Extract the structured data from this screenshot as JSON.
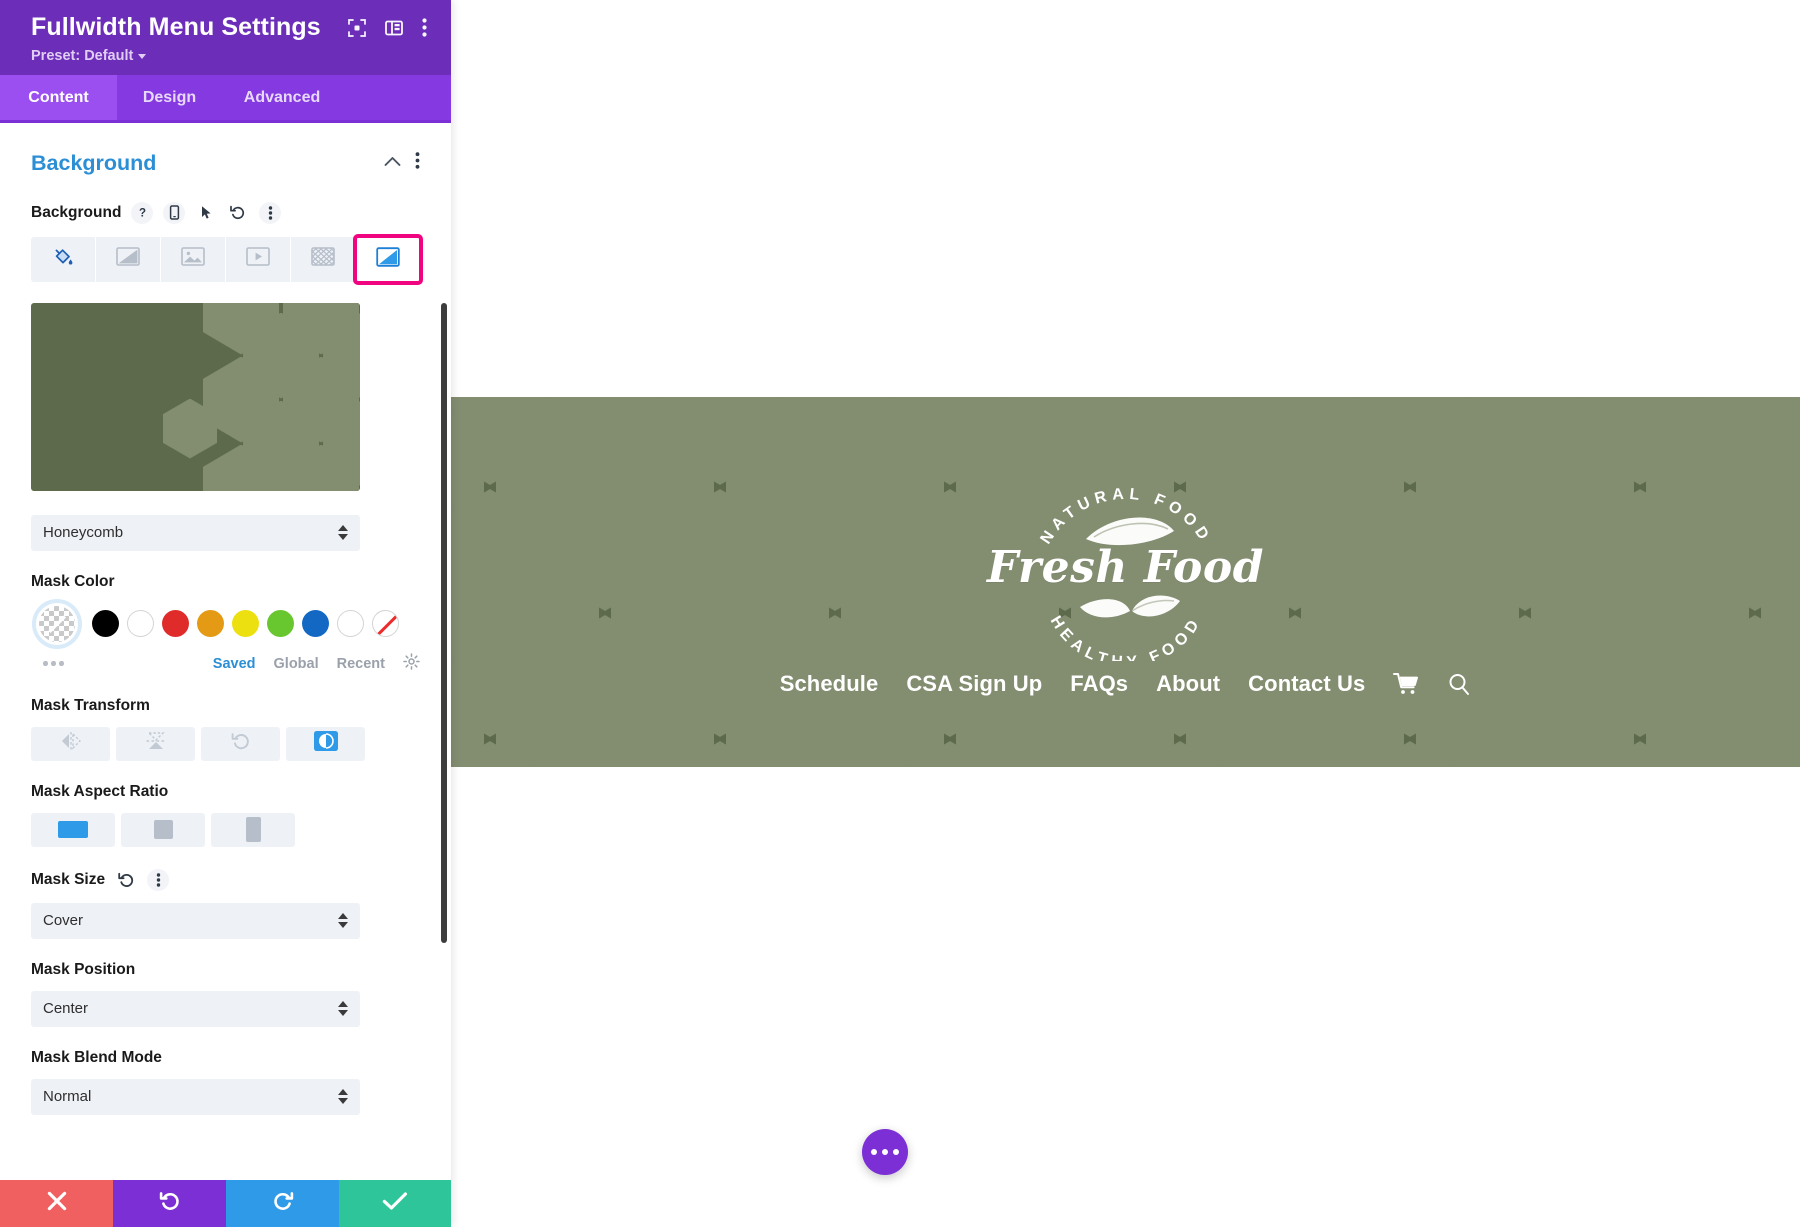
{
  "window": {
    "title": "Fullwidth Menu Settings",
    "preset_label": "Preset: Default",
    "header_icons": [
      "expand-icon",
      "layout-icon",
      "more-vertical-icon"
    ]
  },
  "tabs": [
    {
      "label": "Content",
      "active": true
    },
    {
      "label": "Design",
      "active": false
    },
    {
      "label": "Advanced",
      "active": false
    }
  ],
  "section": {
    "title": "Background",
    "collapse_icon": "chevron-up-icon",
    "more_icon": "more-vertical-icon"
  },
  "background_field": {
    "label": "Background",
    "tool_icons": [
      "help-icon",
      "mobile-icon",
      "cursor-icon",
      "reset-icon",
      "more-vertical-icon"
    ],
    "types": [
      {
        "name": "color",
        "icon": "paint-bucket-icon",
        "selected": false,
        "active_color": true
      },
      {
        "name": "gradient",
        "icon": "gradient-icon",
        "selected": false
      },
      {
        "name": "image",
        "icon": "image-icon",
        "selected": false
      },
      {
        "name": "video",
        "icon": "video-icon",
        "selected": false
      },
      {
        "name": "pattern",
        "icon": "pattern-icon",
        "selected": false
      },
      {
        "name": "mask",
        "icon": "mask-icon",
        "selected": true
      }
    ]
  },
  "mask": {
    "style_value": "Honeycomb",
    "color_label": "Mask Color",
    "swatches": [
      {
        "name": "transparent",
        "color": "transparent",
        "selected": true
      },
      {
        "name": "black",
        "color": "#000000"
      },
      {
        "name": "white",
        "color": "#ffffff"
      },
      {
        "name": "red",
        "color": "#e02b2b"
      },
      {
        "name": "orange",
        "color": "#e59a16"
      },
      {
        "name": "yellow",
        "color": "#ece011"
      },
      {
        "name": "green",
        "color": "#68c72e"
      },
      {
        "name": "blue",
        "color": "#1368c4"
      },
      {
        "name": "white-outline",
        "color": "#ffffff"
      },
      {
        "name": "none",
        "color": "#ffffff"
      }
    ],
    "swatch_tabs": [
      {
        "label": "Saved",
        "active": true
      },
      {
        "label": "Global",
        "active": false
      },
      {
        "label": "Recent",
        "active": false
      }
    ],
    "swatch_settings_icon": "gear-icon",
    "transform_label": "Mask Transform",
    "transforms": [
      {
        "name": "flip-horizontal",
        "icon": "flip-horizontal-icon",
        "active": false
      },
      {
        "name": "flip-vertical",
        "icon": "flip-vertical-icon",
        "active": false
      },
      {
        "name": "rotate",
        "icon": "rotate-icon",
        "active": false
      },
      {
        "name": "invert",
        "icon": "invert-icon",
        "active": true
      }
    ],
    "aspect_label": "Mask Aspect Ratio",
    "aspect_ratios": [
      {
        "name": "landscape",
        "active": true
      },
      {
        "name": "square",
        "active": false
      },
      {
        "name": "portrait",
        "active": false
      }
    ],
    "size_label": "Mask Size",
    "size_icons": [
      "reset-icon",
      "more-vertical-icon"
    ],
    "size_value": "Cover",
    "position_label": "Mask Position",
    "position_value": "Center",
    "blend_label": "Mask Blend Mode",
    "blend_value": "Normal"
  },
  "footer": {
    "buttons": [
      {
        "name": "cancel",
        "icon": "close-icon",
        "color": "#f06060"
      },
      {
        "name": "undo",
        "icon": "undo-icon",
        "color": "#7b2fd4"
      },
      {
        "name": "redo",
        "icon": "redo-icon",
        "color": "#2e9ae8"
      },
      {
        "name": "save",
        "icon": "check-icon",
        "color": "#2fc59a"
      }
    ]
  },
  "canvas": {
    "logo": {
      "top_arc_text": "NATURAL FOOD",
      "script_text": "Fresh Food",
      "bottom_arc_text": "HEALTHY FOOD"
    },
    "menu_items": [
      "Schedule",
      "CSA Sign Up",
      "FAQs",
      "About",
      "Contact Us"
    ],
    "menu_icons": [
      "cart-icon",
      "search-icon"
    ],
    "background_color": "#5d6a4c",
    "pattern_color": "#838d70",
    "fab_icon": "ellipsis-icon",
    "fab_color": "#7b2fd4"
  }
}
